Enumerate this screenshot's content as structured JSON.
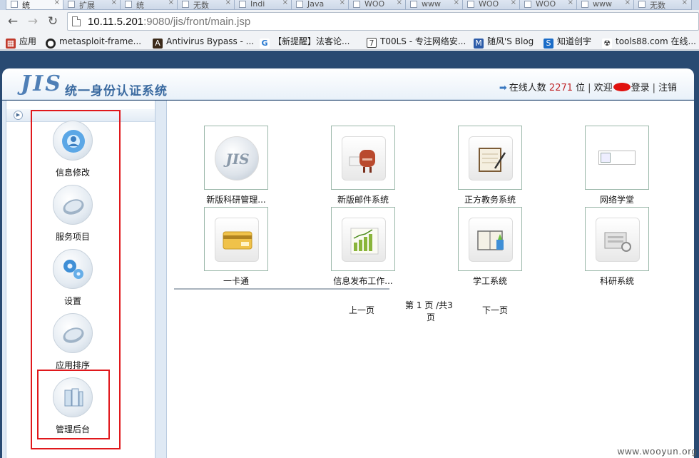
{
  "browser": {
    "tabs": [
      "统",
      "扩展",
      "统",
      "无数",
      "Indi",
      "Java",
      "WOO",
      "www",
      "WOO",
      "WOO",
      "www",
      "无数"
    ],
    "url_host": "10.11.5.201",
    "url_path": ":9080/jis/front/main.jsp",
    "bookmarks": [
      {
        "label": "应用",
        "icon": "apps-icon",
        "color": "#c0392b"
      },
      {
        "label": "metasploit-frame...",
        "icon": "github-icon",
        "color": "#222222"
      },
      {
        "label": "Antivirus Bypass - ...",
        "icon": "bookmark-icon",
        "color": "#3b2a1a"
      },
      {
        "label": "【新提醒】法客论...",
        "icon": "refresh-icon",
        "color": "#2a7ad0"
      },
      {
        "label": "T00LS - 专注网络安...",
        "icon": "slash-icon",
        "color": "#444444"
      },
      {
        "label": "随风'S Blog",
        "icon": "m-icon",
        "color": "#2d5ca8"
      },
      {
        "label": "知道创宇",
        "icon": "s-icon",
        "color": "#1b6cc7"
      },
      {
        "label": "tools88.com 在线...",
        "icon": "radiation-icon",
        "color": "#333333"
      }
    ]
  },
  "header": {
    "logo": "JIS",
    "title": "统一身份认证系统",
    "online_prefix": "在线人数",
    "online_count": "2271",
    "online_suffix": "位",
    "welcome": "欢迎",
    "login": "登录",
    "logout": "注销"
  },
  "sidebar": {
    "items": [
      {
        "label": "信息修改",
        "icon": "user-info-icon"
      },
      {
        "label": "服务项目",
        "icon": "mouse-icon"
      },
      {
        "label": "设置",
        "icon": "gears-icon"
      },
      {
        "label": "应用排序",
        "icon": "mouse-icon"
      },
      {
        "label": "管理后台",
        "icon": "admin-panel-icon"
      }
    ]
  },
  "apps": [
    {
      "label": "新版科研管理...",
      "icon": "jis-logo-icon"
    },
    {
      "label": "新版邮件系统",
      "icon": "mailbox-icon"
    },
    {
      "label": "正方教务系统",
      "icon": "notepad-icon"
    },
    {
      "label": "网络学堂",
      "icon": "broken-image-icon"
    },
    {
      "label": "一卡通",
      "icon": "card-icon"
    },
    {
      "label": "信息发布工作...",
      "icon": "bar-chart-icon"
    },
    {
      "label": "学工系统",
      "icon": "book-icon"
    },
    {
      "label": "科研系统",
      "icon": "research-icon"
    }
  ],
  "pager": {
    "prev": "上一页",
    "page_prefix": "第",
    "current": "1",
    "page_mid": "页 /共3",
    "page_suffix": "页",
    "next": "下一页"
  },
  "watermark": "www.wooyun.org",
  "colors": {
    "accent": "#3a6aa0",
    "highlight": "#e0181c",
    "count": "#c0282a",
    "frame": "#294a72"
  }
}
